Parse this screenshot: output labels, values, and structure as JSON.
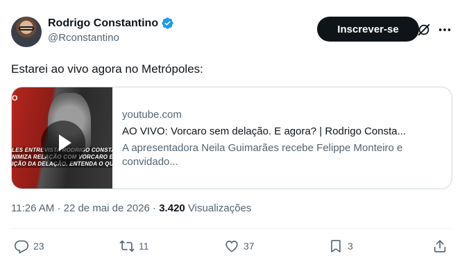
{
  "author": {
    "name": "Rodrigo Constantino",
    "handle": "@Rconstantino"
  },
  "header": {
    "subscribe_label": "Inscrever-se",
    "grok_icon": "grok-slash-icon",
    "more_icon": "ellipsis-icon"
  },
  "tweet": {
    "text": "Estarei ao vivo agora no Metrópoles:"
  },
  "card": {
    "domain": "youtube.com",
    "title": "AO VIVO: Vorcaro sem delação. E agora? | Rodrigo Consta...",
    "description": "A apresentadora Neila Guimarães recebe Felippe Monteiro e convidado...",
    "thumbnail_overlay": [
      "LES ENTREVISTA RODRIGO CONSTANTINO",
      "NIMIZA RELAÇÃO COM VORCARO EM DEFE",
      "IÇÃO DA DELAÇÃO. ENTENDA O QUE ACON"
    ],
    "thumbnail_logo": "O"
  },
  "meta": {
    "time": "11:26 AM",
    "separator": "·",
    "date": "22 de mai de 2026",
    "views_count": "3.420",
    "views_label": "Visualizações"
  },
  "actions": {
    "replies": "23",
    "reposts": "11",
    "likes": "37",
    "bookmarks": "3"
  },
  "colors": {
    "text_primary": "#0f1419",
    "text_secondary": "#536471",
    "verified": "#1d9bf0",
    "border": "#cfd9de"
  }
}
